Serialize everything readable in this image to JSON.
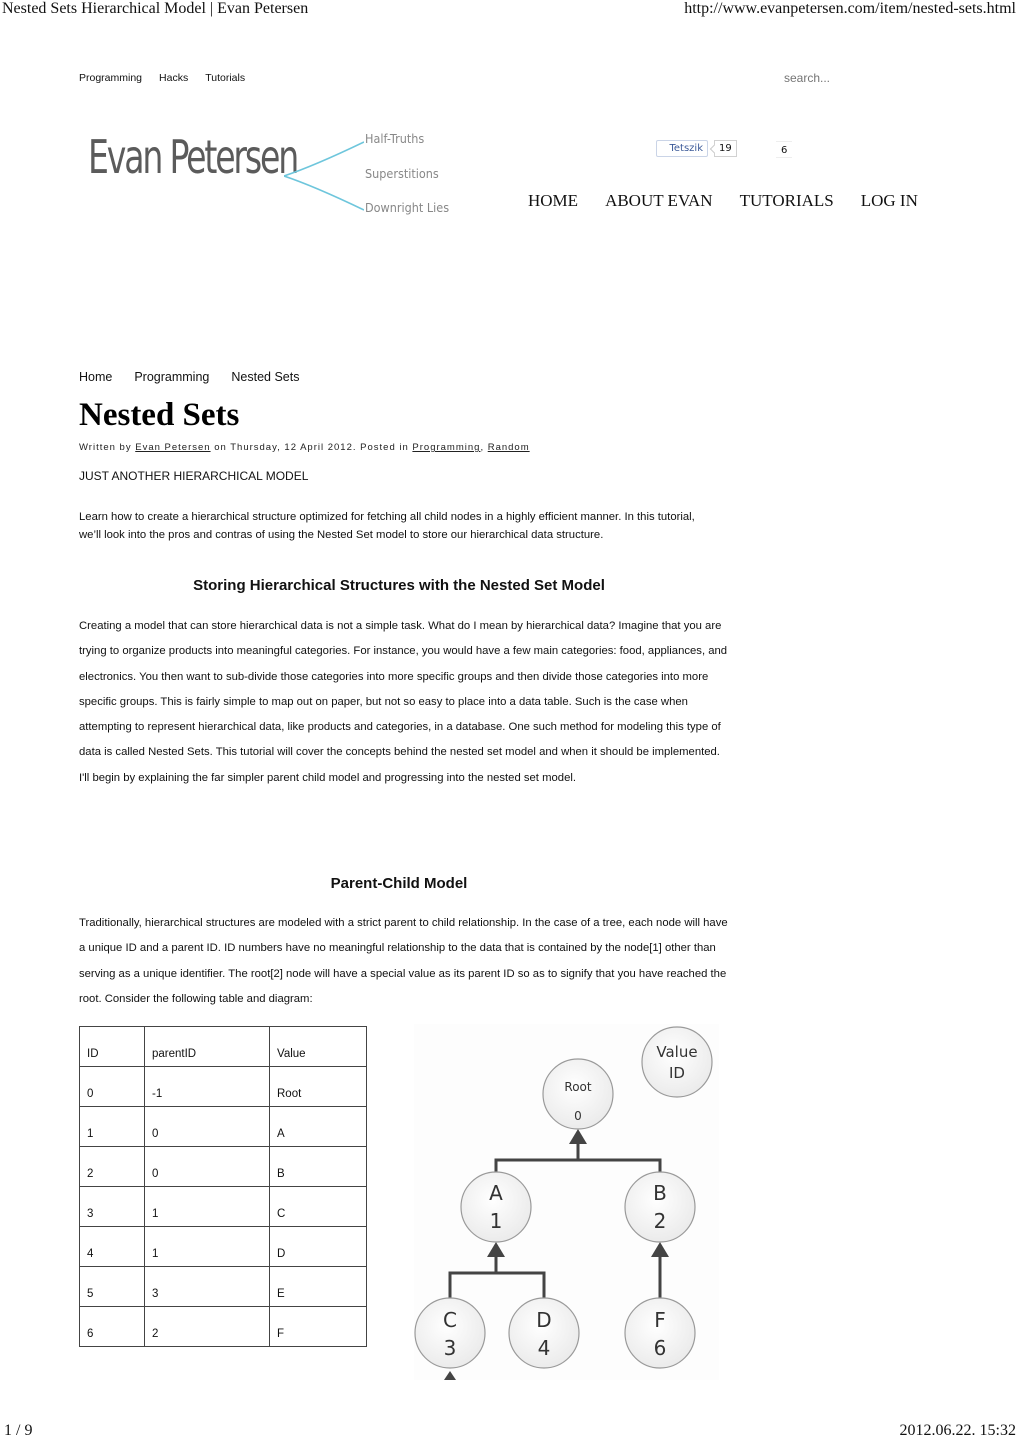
{
  "pdf": {
    "header_title": "Nested Sets Hierarchical Model | Evan Petersen",
    "header_url": "http://www.evanpetersen.com/item/nested-sets.html",
    "page_indicator": "1 / 9",
    "timestamp": "2012.06.22. 15:32"
  },
  "topnav": {
    "items": [
      "Programming",
      "Hacks",
      "Tutorials"
    ]
  },
  "search": {
    "placeholder": "search..."
  },
  "logo": {
    "name": "Evan Petersen",
    "taglines": [
      "Half-Truths",
      "Superstitions",
      "Downright Lies"
    ],
    "accent_color": "#6ec6dc"
  },
  "social": {
    "like_label": "Tetszik",
    "like_count": "19",
    "tweet_count": "6",
    "like_color": "#3b5998"
  },
  "mainnav": {
    "items": [
      "HOME",
      "ABOUT EVAN",
      "TUTORIALS",
      "LOG IN"
    ]
  },
  "breadcrumb": [
    "Home",
    "Programming",
    "Nested Sets"
  ],
  "article": {
    "title": "Nested Sets",
    "byline": {
      "prefix": "Written by ",
      "author": "Evan Petersen",
      "middle": " on Thursday, 12 April 2012. Posted in ",
      "cat1": "Programming",
      "sep": ", ",
      "cat2": "Random"
    },
    "subtitle": "JUST ANOTHER HIERARCHICAL MODEL",
    "intro": "Learn how to create a hierarchical structure optimized for fetching all child nodes in a highly efficient manner. In this tutorial, we’ll look into the pros and contras of using the Nested Set model to store our hierarchical data structure.",
    "section1_heading": "Storing Hierarchical Structures with the Nested Set Model",
    "section1_body": "Creating a model that can store hierarchical data is not a simple task.  What do I mean by hierarchical data?  Imagine that you are trying to organize products into meaningful categories.  For instance, you would have a few main categories: food, appliances, and electronics.  You then want to sub-divide those categories into more specific groups and then divide those categories into more specific groups.  This is fairly simple to map out on paper, but not so easy to place into a data table.  Such is the case when attempting to represent hierarchical data, like products and categories, in a database.  One such method for modeling this type of data is called Nested Sets.  This tutorial will cover the concepts behind the nested set model and when it should be implemented.  I'll begin by explaining the far simpler parent child model and progressing into the nested set model.",
    "section2_heading": "Parent-Child Model",
    "section2_body": "Traditionally, hierarchical structures are modeled with a strict parent to child relationship.  In the case of a tree, each node will have a unique ID and a parent ID.  ID numbers have no meaningful relationship to the data that is contained by the node[1] other than serving as a unique identifier.  The root[2] node will have a special value as its parent ID so as to signify that you have reached the root.  Consider the following table and diagram:"
  },
  "table": {
    "headers": [
      "ID",
      "parentID",
      "Value"
    ],
    "rows": [
      [
        "0",
        "-1",
        "Root"
      ],
      [
        "1",
        "0",
        "A"
      ],
      [
        "2",
        "0",
        "B"
      ],
      [
        "3",
        "1",
        "C"
      ],
      [
        "4",
        "1",
        "D"
      ],
      [
        "5",
        "3",
        "E"
      ],
      [
        "6",
        "2",
        "F"
      ]
    ]
  },
  "diagram": {
    "legend": {
      "line1": "Value",
      "line2": "ID"
    },
    "nodes": [
      {
        "value": "Root",
        "id": "0"
      },
      {
        "value": "A",
        "id": "1"
      },
      {
        "value": "B",
        "id": "2"
      },
      {
        "value": "C",
        "id": "3"
      },
      {
        "value": "D",
        "id": "4"
      },
      {
        "value": "F",
        "id": "6"
      }
    ]
  }
}
